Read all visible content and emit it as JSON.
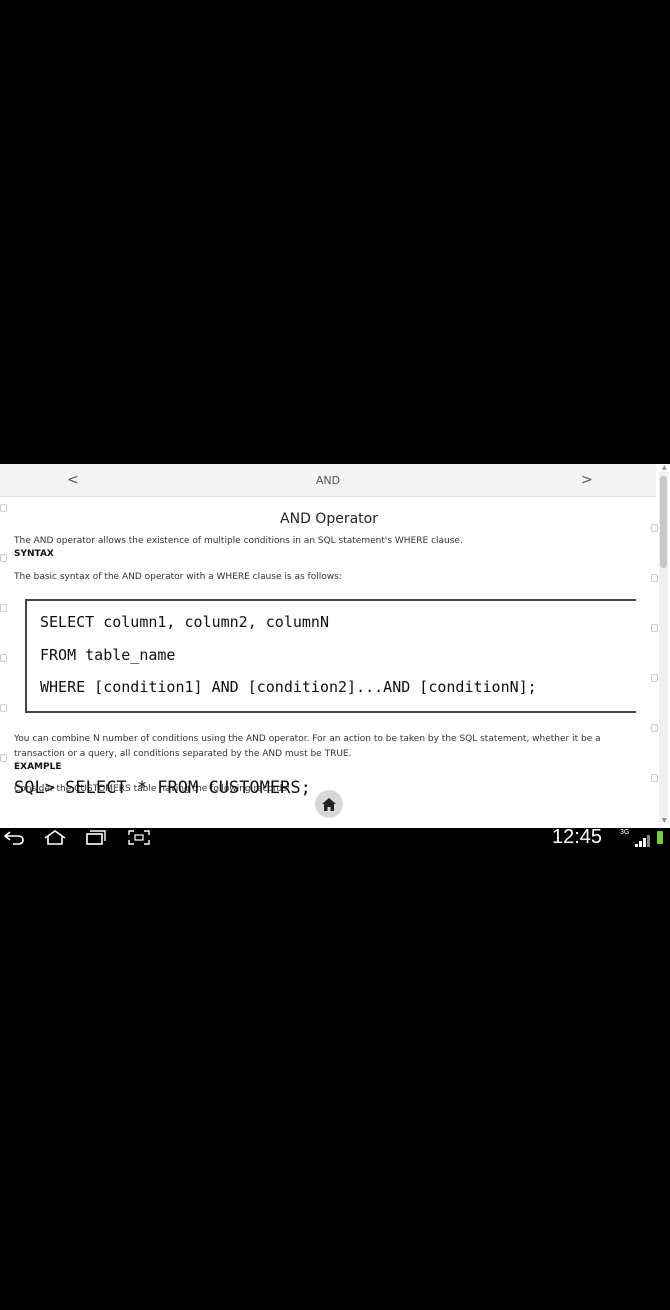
{
  "topbar": {
    "title": "AND",
    "prev_label": "<",
    "next_label": ">"
  },
  "article": {
    "heading": "AND Operator",
    "intro": "The AND operator allows the existence of multiple conditions in an SQL statement's WHERE clause.",
    "syntax_label": "SYNTAX",
    "syntax_text": "The basic syntax of the AND operator with a WHERE clause is as follows:",
    "code_lines": [
      "SELECT column1, column2, columnN",
      "FROM table_name",
      "WHERE [condition1] AND [condition2]...AND [conditionN];"
    ],
    "combine_text_1": "You can combine N number of conditions using the AND operator. For an action to be taken by the SQL statement, whether it be a",
    "combine_text_2": "transaction or a query, all conditions separated by the AND must be TRUE.",
    "example_label": "EXAMPLE",
    "example_text": "Consider the CUSTOMERS table having the following records:",
    "code_peek": "SQL> SELECT * FROM CUSTOMERS;"
  },
  "status_bar": {
    "time": "12:45",
    "network": "3G",
    "battery_color": "#7ac943"
  },
  "icons": {
    "home": "home-icon",
    "back": "back-icon",
    "launcher": "home-outline-icon",
    "recents": "recent-apps-icon",
    "screenshot": "screenshot-icon"
  }
}
